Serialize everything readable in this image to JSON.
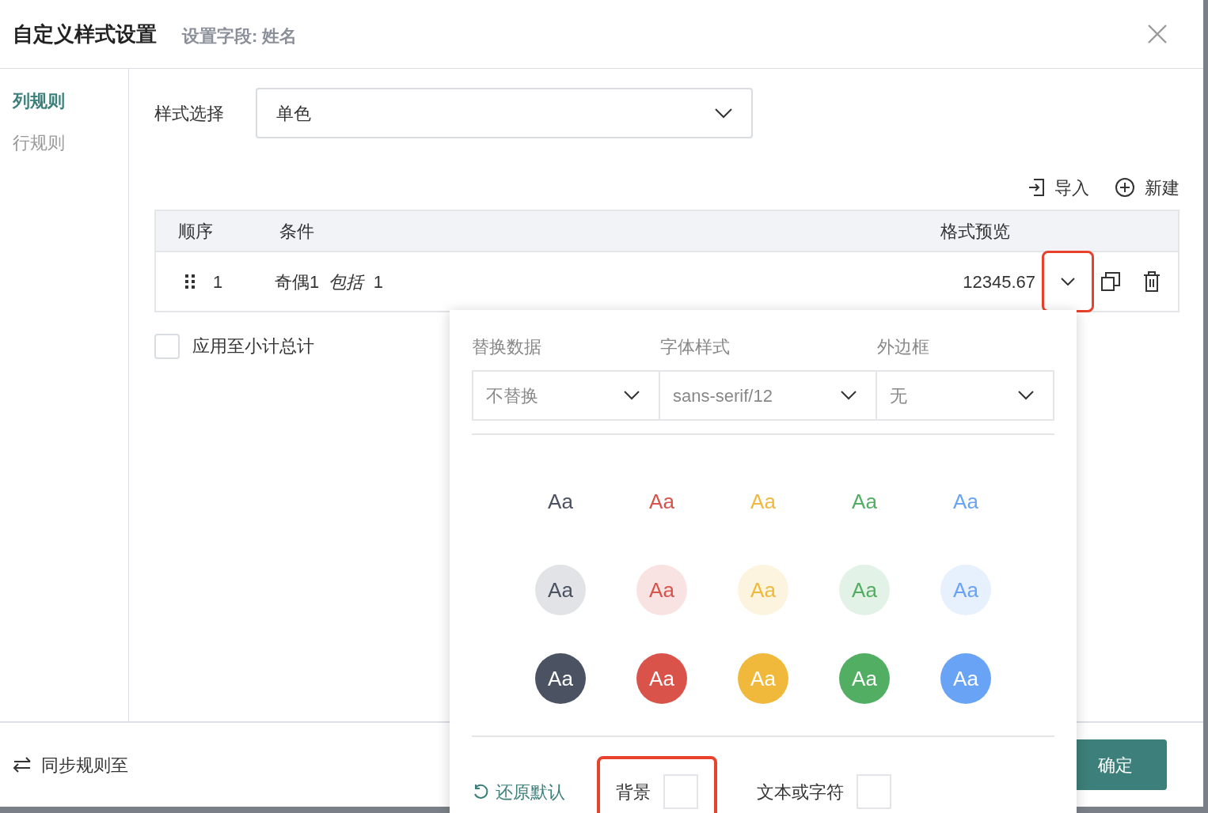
{
  "dialog": {
    "title": "自定义样式设置",
    "subtitle": "设置字段: 姓名"
  },
  "sidebar": {
    "items": [
      {
        "label": "列规则",
        "selected": true
      },
      {
        "label": "行规则",
        "selected": false
      }
    ]
  },
  "style_select": {
    "label": "样式选择",
    "value": "单色"
  },
  "toolbar": {
    "import": "导入",
    "new": "新建"
  },
  "table": {
    "columns": [
      "顺序",
      "条件",
      "格式预览"
    ],
    "rows": [
      {
        "order": "1",
        "condition_field": "奇偶1",
        "condition_op": "包括",
        "condition_value": "1",
        "preview": "12345.67",
        "dropdown_highlighted": true
      }
    ]
  },
  "apply_subtotal": {
    "label": "应用至小计总计",
    "checked": false
  },
  "footer": {
    "sync": "同步规则至",
    "confirm": "确定"
  },
  "popup": {
    "fields": [
      {
        "label": "替换数据",
        "value": "不替换"
      },
      {
        "label": "字体样式",
        "value": "sans-serif/12"
      },
      {
        "label": "外边框",
        "value": "无"
      }
    ],
    "swatch_rows": [
      {
        "kind": "text",
        "items": [
          {
            "text": "Aa",
            "color": "#4b5261"
          },
          {
            "text": "Aa",
            "color": "#d9534a"
          },
          {
            "text": "Aa",
            "color": "#f0b93b"
          },
          {
            "text": "Aa",
            "color": "#52ae62"
          },
          {
            "text": "Aa",
            "color": "#69a3f5"
          }
        ]
      },
      {
        "kind": "light",
        "items": [
          {
            "text": "Aa",
            "color": "#4b5261"
          },
          {
            "text": "Aa",
            "color": "#d9534a"
          },
          {
            "text": "Aa",
            "color": "#f0b93b"
          },
          {
            "text": "Aa",
            "color": "#52ae62"
          },
          {
            "text": "Aa",
            "color": "#69a3f5"
          }
        ]
      },
      {
        "kind": "solid",
        "items": [
          {
            "text": "Aa",
            "color": "#4b5261"
          },
          {
            "text": "Aa",
            "color": "#d9534a"
          },
          {
            "text": "Aa",
            "color": "#f0b93b"
          },
          {
            "text": "Aa",
            "color": "#52ae62"
          },
          {
            "text": "Aa",
            "color": "#69a3f5"
          }
        ]
      }
    ],
    "reset": "还原默认",
    "color_options": [
      {
        "label": "背景",
        "highlighted": true
      },
      {
        "label": "文本或字符",
        "highlighted": false
      }
    ]
  }
}
